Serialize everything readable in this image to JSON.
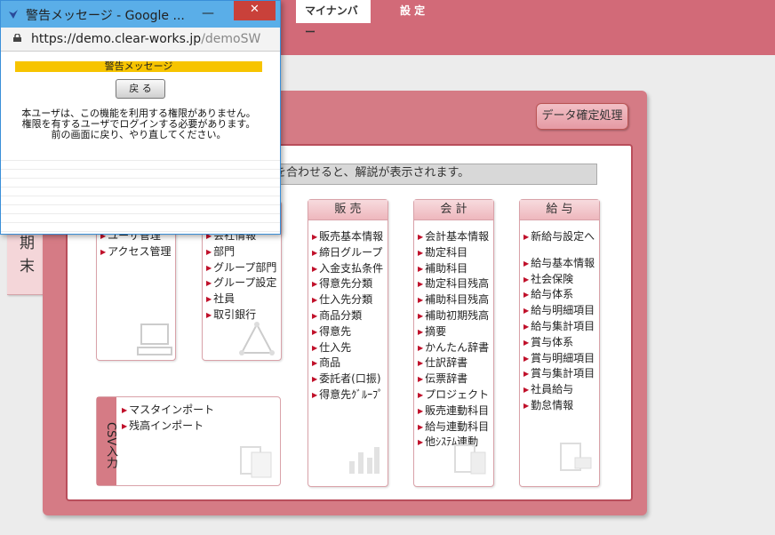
{
  "nav": {
    "mynumber": "マイナンバー",
    "settings": "設 定"
  },
  "left_stub": {
    "char1": "期",
    "char2": "末"
  },
  "confirm_button": "データ確定処理",
  "hint_text": "を合わせると、解説が表示されます。",
  "boxes": {
    "partial1": {
      "items": [
        "ユーザ管理",
        "アクセス管理"
      ]
    },
    "partial2": {
      "items": [
        "会社情報",
        "部門",
        "グループ部門",
        "グループ設定",
        "社員",
        "取引銀行"
      ]
    },
    "sales": {
      "title": "販 売",
      "items": [
        "販売基本情報",
        "締日グループ",
        "入金支払条件",
        "得意先分類",
        "仕入先分類",
        "商品分類",
        "得意先",
        "仕入先",
        "商品",
        "委託者(口振)",
        "得意先ｸﾞﾙｰﾌﾟ"
      ]
    },
    "accounting": {
      "title": "会 計",
      "items": [
        "会計基本情報",
        "勘定科目",
        "補助科目",
        "勘定科目残高",
        "補助科目残高",
        "補助初期残高",
        "摘要",
        "かんたん辞書",
        "仕訳辞書",
        "伝票辞書",
        "プロジェクト",
        "販売連動科目",
        "給与連動科目",
        "他ｼｽﾃﾑ連動"
      ]
    },
    "payroll": {
      "title": "給 与",
      "first_item": "新給与設定へ",
      "items": [
        "給与基本情報",
        "社会保険",
        "給与体系",
        "給与明細項目",
        "給与集計項目",
        "賞与体系",
        "賞与明細項目",
        "賞与集計項目",
        "社員給与",
        "勤怠情報"
      ]
    },
    "csv": {
      "side": "CSV入力",
      "items": [
        "マスタインポート",
        "残高インポート"
      ]
    }
  },
  "popup": {
    "title": "警告メッセージ - Google ...",
    "minimize": "—",
    "close": "✕",
    "url_main": "https://demo.clear-works.jp",
    "url_rest": "/demoSW",
    "header": "警告メッセージ",
    "back_button": "戻 る",
    "message": [
      "本ユーザは、この機能を利用する権限がありません。",
      "権限を有するユーザでログインする必要があります。",
      "前の画面に戻り、やり直してください。"
    ]
  },
  "colors": {
    "accent": "#d26a78",
    "frame": "#d57b85",
    "warning": "#f7c400",
    "popup_title": "#5aaee8",
    "close": "#c9413a"
  }
}
